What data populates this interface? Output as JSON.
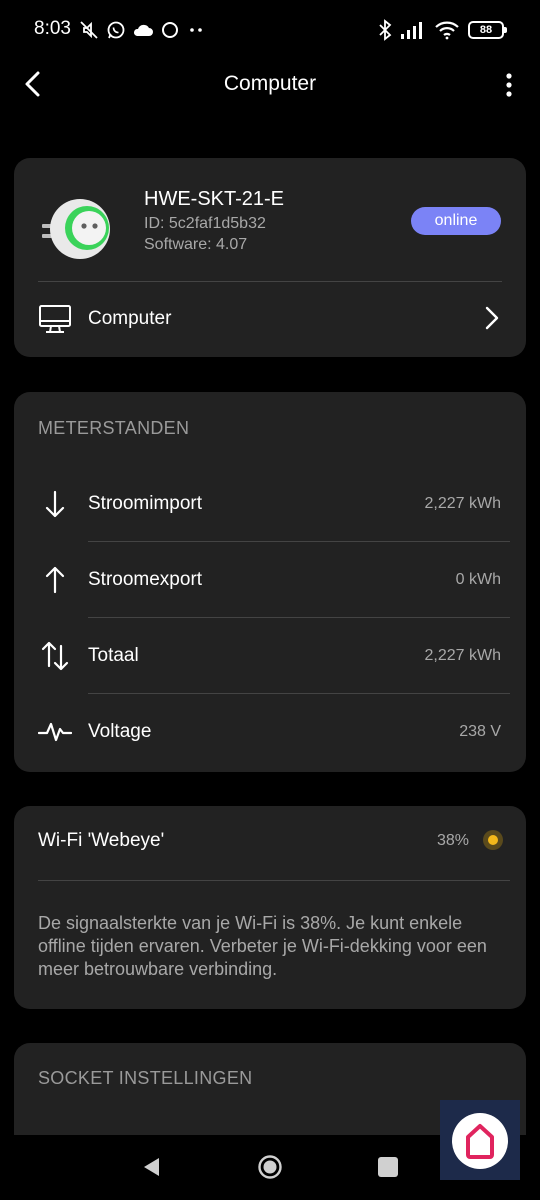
{
  "status_bar": {
    "time": "8:03",
    "battery": "88",
    "icons_left": [
      "mute-icon",
      "whatsapp-icon",
      "cloud-icon",
      "circle-icon",
      "more-dots-icon"
    ],
    "icons_right": [
      "bluetooth-icon",
      "signal-icon",
      "wifi-icon",
      "battery-icon"
    ]
  },
  "app_bar": {
    "title": "Computer"
  },
  "device": {
    "name": "HWE-SKT-21-E",
    "id": "ID: 5c2faf1d5b32",
    "software": "Software: 4.07",
    "status": "online",
    "status_color": "#7b83f6",
    "linked_label": "Computer"
  },
  "meters": {
    "title": "METERSTANDEN",
    "rows": [
      {
        "label": "Stroomimport",
        "value": "2,227 kWh",
        "icon": "arrow-down-icon"
      },
      {
        "label": "Stroomexport",
        "value": "0 kWh",
        "icon": "arrow-up-icon"
      },
      {
        "label": "Totaal",
        "value": "2,227 kWh",
        "icon": "arrows-up-down-icon"
      },
      {
        "label": "Voltage",
        "value": "238 V",
        "icon": "pulse-icon"
      }
    ]
  },
  "wifi": {
    "label": "Wi-Fi 'Webeye'",
    "strength": "38%",
    "indicator_color": "#f3b81b",
    "description": "De signaalsterkte van je Wi-Fi is 38%. Je kunt enkele offline tijden ervaren. Verbeter je Wi-Fi-dekking voor een meer betrouwbare verbinding."
  },
  "socket": {
    "title": "SOCKET INSTELLINGEN"
  },
  "nav": {
    "items": [
      "back-icon",
      "home-icon",
      "recents-icon"
    ]
  }
}
